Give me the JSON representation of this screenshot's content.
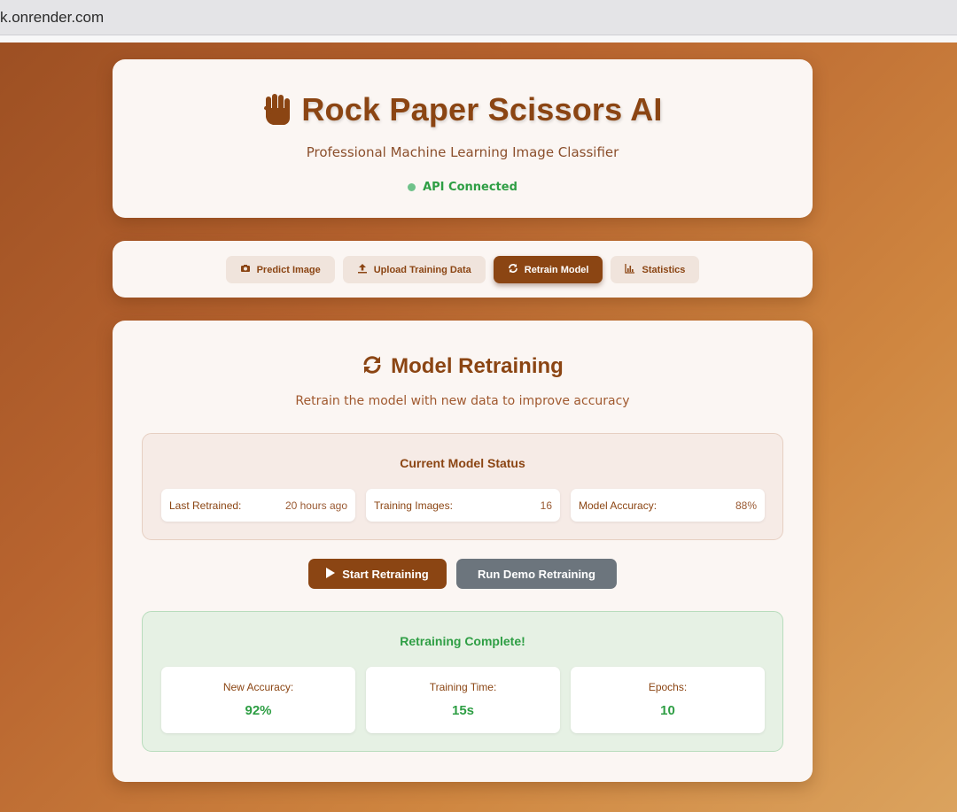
{
  "browser": {
    "url": "k.onrender.com"
  },
  "header": {
    "title": "Rock Paper Scissors AI",
    "subtitle": "Professional Machine Learning Image Classifier",
    "api_status": "API Connected",
    "icon": "raised-fist-icon"
  },
  "nav": {
    "tabs": [
      {
        "label": "Predict Image",
        "icon": "camera-icon",
        "active": false
      },
      {
        "label": "Upload Training Data",
        "icon": "upload-icon",
        "active": false
      },
      {
        "label": "Retrain Model",
        "icon": "refresh-icon",
        "active": true
      },
      {
        "label": "Statistics",
        "icon": "chart-icon",
        "active": false
      }
    ]
  },
  "retrain": {
    "title": "Model Retraining",
    "subtitle": "Retrain the model with new data to improve accuracy",
    "status_panel": {
      "title": "Current Model Status",
      "items": [
        {
          "label": "Last Retrained:",
          "value": "20 hours ago"
        },
        {
          "label": "Training Images:",
          "value": "16"
        },
        {
          "label": "Model Accuracy:",
          "value": "88%"
        }
      ]
    },
    "buttons": {
      "start": "Start Retraining",
      "demo": "Run Demo Retraining"
    },
    "result_panel": {
      "title": "Retraining Complete!",
      "items": [
        {
          "label": "New Accuracy:",
          "value": "92%"
        },
        {
          "label": "Training Time:",
          "value": "15s"
        },
        {
          "label": "Epochs:",
          "value": "10"
        }
      ]
    }
  },
  "colors": {
    "brand": "#8b4513",
    "success": "#2e9e44",
    "secondary_button": "#6c757d"
  }
}
